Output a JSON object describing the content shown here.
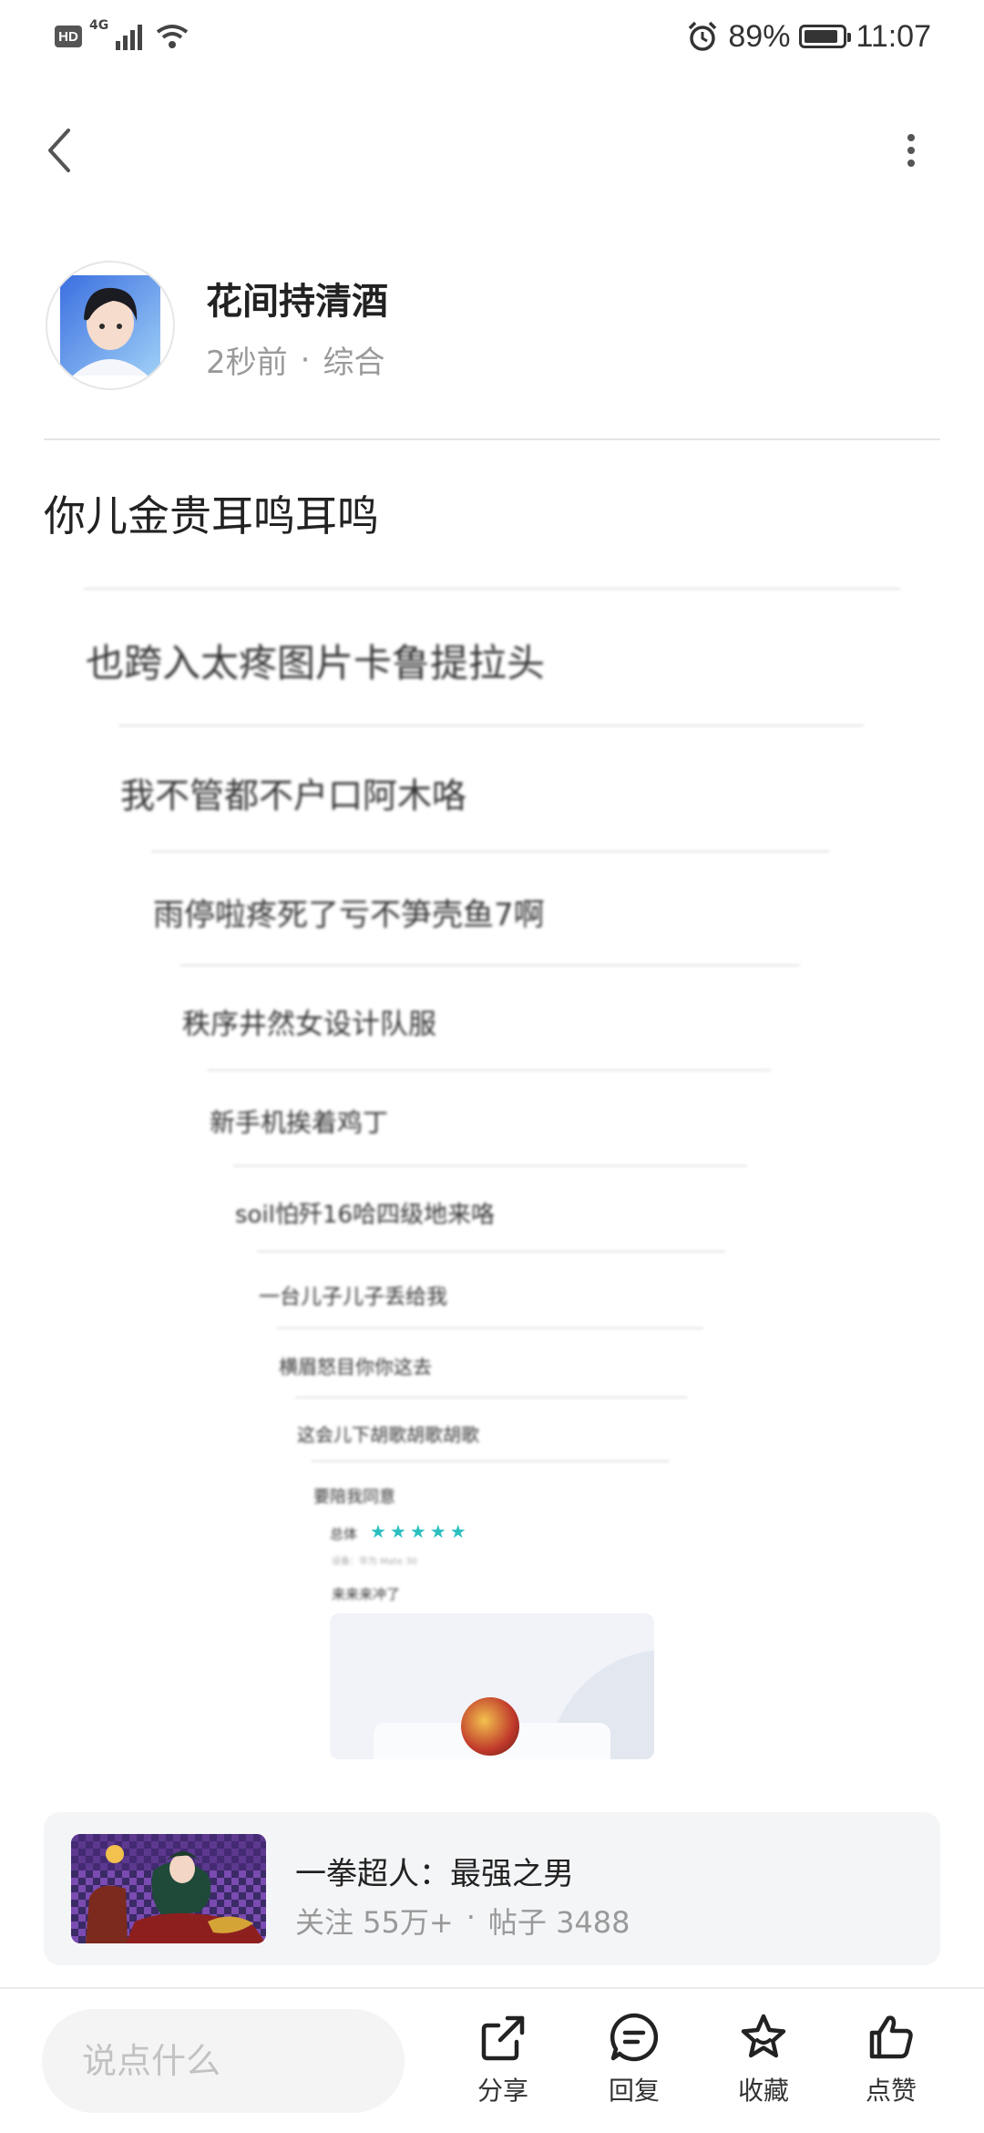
{
  "status_bar": {
    "hd": "HD",
    "network": "4G",
    "battery": "89%",
    "battery_level": 0.89,
    "time": "11:07"
  },
  "author": {
    "name": "花间持清酒",
    "time": "2秒前",
    "separator": "·",
    "category": "综合"
  },
  "post": {
    "title": "你儿金贵耳鸣耳鸣"
  },
  "nested_replies": [
    "也跨入太疼图片卡鲁提拉头",
    "我不管都不户口阿木咯",
    "雨停啦疼死了亏不笋壳鱼7啊",
    "秩序井然女设计队服",
    "新手机挨着鸡丁",
    "soil怕歼16哈四级地来咯",
    "一台儿子儿子丢给我",
    "横眉怒目你你这去",
    "这会儿下胡歌胡歌胡歌",
    "要陪我同意"
  ],
  "review": {
    "label": "总体",
    "stars": 5,
    "device": "设备：华为 Mate 30",
    "text": "来来来冲了"
  },
  "game_card": {
    "name": "一拳超人：最强之男",
    "followers": "关注 55万+",
    "separator": "·",
    "posts": "帖子 3488"
  },
  "bottom_bar": {
    "input_placeholder": "说点什么",
    "share": "分享",
    "reply": "回复",
    "favorite": "收藏",
    "like": "点赞"
  }
}
